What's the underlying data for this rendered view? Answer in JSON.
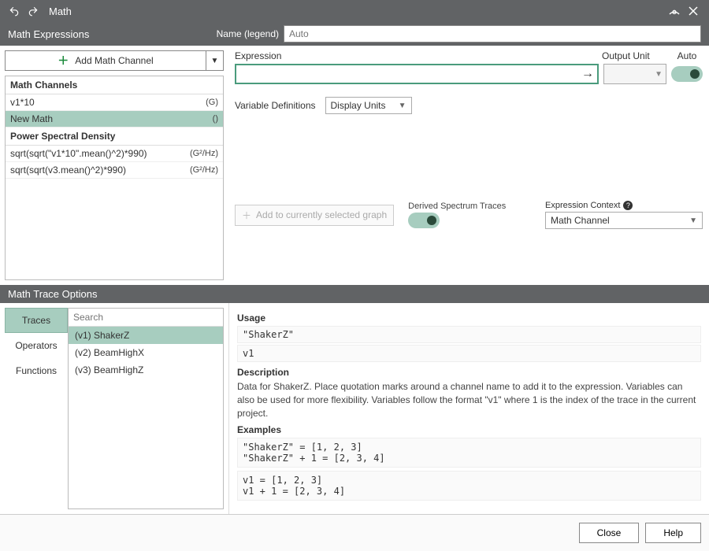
{
  "titlebar": {
    "title": "Math"
  },
  "section_expressions": "Math Expressions",
  "name_label": "Name (legend)",
  "name_placeholder": "Auto",
  "add_channel_label": "Add Math Channel",
  "channels": {
    "group1": "Math Channels",
    "items1": [
      {
        "label": "v1*10",
        "unit": "(G)"
      },
      {
        "label": "New Math",
        "unit": "()"
      }
    ],
    "group2": "Power Spectral Density",
    "items2": [
      {
        "label": "sqrt(sqrt(\"v1*10\".mean()^2)*990)",
        "unit": "(G²/Hz)"
      },
      {
        "label": "sqrt(sqrt(v3.mean()^2)*990)",
        "unit": "(G²/Hz)"
      }
    ]
  },
  "expr": {
    "expression_label": "Expression",
    "output_unit_label": "Output Unit",
    "auto_label": "Auto",
    "var_def_label": "Variable Definitions",
    "var_def_value": "Display Units",
    "add_graph_label": "Add to currently selected graph",
    "derived_label": "Derived Spectrum Traces",
    "context_label": "Expression Context",
    "context_value": "Math Channel"
  },
  "section_trace": "Math Trace Options",
  "trace": {
    "tabs": [
      "Traces",
      "Operators",
      "Functions"
    ],
    "search_placeholder": "Search",
    "items": [
      "(v1) ShakerZ",
      "(v2) BeamHighX",
      "(v3) BeamHighZ"
    ],
    "usage_label": "Usage",
    "usage_lines": [
      "\"ShakerZ\"",
      "v1"
    ],
    "description_label": "Description",
    "description_text": "Data for ShakerZ. Place quotation marks around a channel name to add it to the expression. Variables can also be used for more flexibility. Variables follow the format \"v1\" where 1 is the index of the trace in the current project.",
    "examples_label": "Examples",
    "examples": [
      "\"ShakerZ\" = [1, 2, 3]\n\"ShakerZ\" + 1 = [2, 3, 4]",
      "v1 = [1, 2, 3]\nv1 + 1 = [2, 3, 4]"
    ]
  },
  "footer": {
    "close": "Close",
    "help": "Help"
  }
}
